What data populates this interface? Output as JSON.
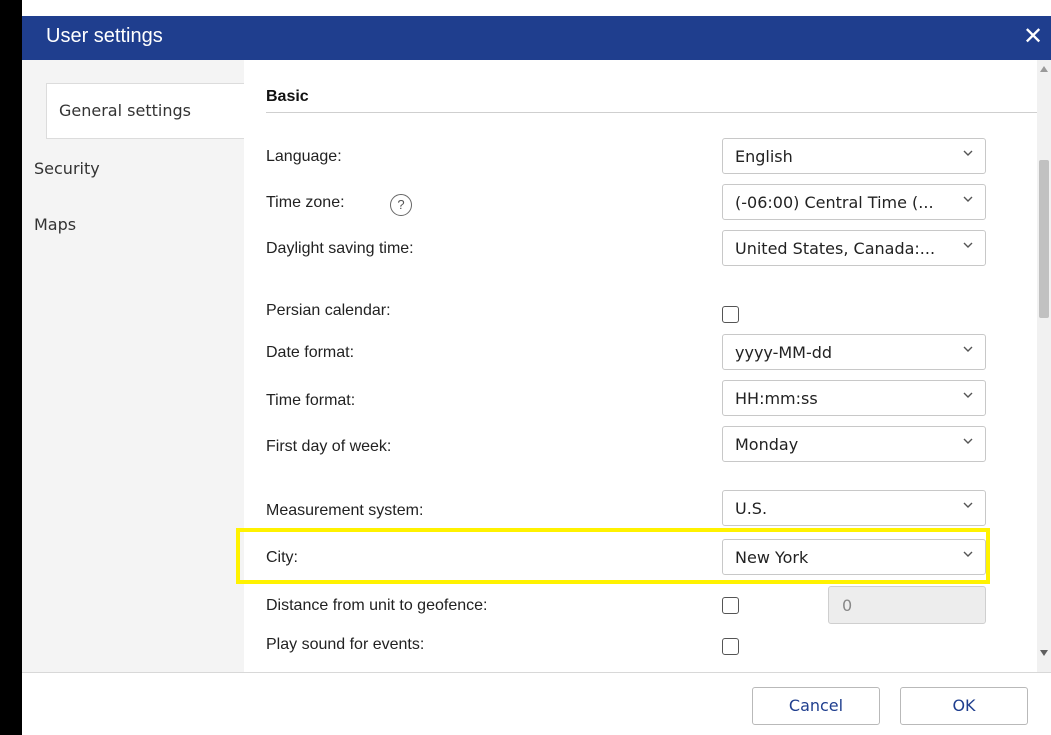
{
  "window": {
    "title": "User settings"
  },
  "sidebar": {
    "items": [
      {
        "label": "General settings",
        "active": true
      },
      {
        "label": "Security",
        "active": false
      },
      {
        "label": "Maps",
        "active": false
      }
    ]
  },
  "section": {
    "title": "Basic"
  },
  "fields": {
    "language": {
      "label": "Language:",
      "value": "English"
    },
    "timezone": {
      "label": "Time zone:",
      "value": "(-06:00) Central Time (..."
    },
    "dst": {
      "label": "Daylight saving time:",
      "value": "United States, Canada:..."
    },
    "persian": {
      "label": "Persian calendar:"
    },
    "date_format": {
      "label": "Date format:",
      "value": "yyyy-MM-dd"
    },
    "time_format": {
      "label": "Time format:",
      "value": "HH:mm:ss"
    },
    "first_day": {
      "label": "First day of week:",
      "value": "Monday"
    },
    "measurement": {
      "label": "Measurement system:",
      "value": "U.S."
    },
    "city": {
      "label": "City:",
      "value": "New York"
    },
    "geofence_distance": {
      "label": "Distance from unit to geofence:",
      "value": "0"
    },
    "play_sound": {
      "label": "Play sound for events:"
    }
  },
  "footer": {
    "cancel_label": "Cancel",
    "ok_label": "OK"
  },
  "colors": {
    "titlebar": "#1f3e8e",
    "highlight": "#fff200"
  }
}
